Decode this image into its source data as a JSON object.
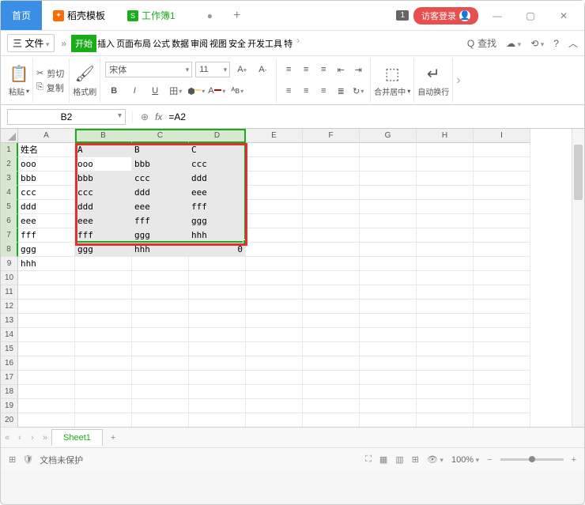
{
  "titlebar": {
    "home": "首页",
    "tab2": "稻壳模板",
    "tab3": "工作簿1",
    "badge": "1",
    "login": "访客登录"
  },
  "menubar": {
    "file": "三 文件",
    "more": "»",
    "tabs": [
      "开始",
      "插入",
      "页面布局",
      "公式",
      "数据",
      "审阅",
      "视图",
      "安全",
      "开发工具",
      "特"
    ],
    "search": "查找"
  },
  "ribbon": {
    "paste": "粘贴",
    "cut": "剪切",
    "copy": "复制",
    "format_painter": "格式刷",
    "font_name": "宋体",
    "font_size": "11",
    "merge": "合并居中",
    "wrap": "自动换行"
  },
  "formula": {
    "namebox": "B2",
    "fx": "fx",
    "value": "=A2"
  },
  "grid": {
    "cols": [
      "A",
      "B",
      "C",
      "D",
      "E",
      "F",
      "G",
      "H",
      "I"
    ],
    "rows": [
      "1",
      "2",
      "3",
      "4",
      "5",
      "6",
      "7",
      "8",
      "9",
      "10",
      "11",
      "12",
      "13",
      "14",
      "15",
      "16",
      "17",
      "18",
      "19",
      "20"
    ],
    "data": [
      [
        "姓名",
        "A",
        "B",
        "C",
        "",
        "",
        "",
        "",
        ""
      ],
      [
        "ooo",
        "ooo",
        "bbb",
        "ccc",
        "",
        "",
        "",
        "",
        ""
      ],
      [
        "bbb",
        "bbb",
        "ccc",
        "ddd",
        "",
        "",
        "",
        "",
        ""
      ],
      [
        "ccc",
        "ccc",
        "ddd",
        "eee",
        "",
        "",
        "",
        "",
        ""
      ],
      [
        "ddd",
        "ddd",
        "eee",
        "fff",
        "",
        "",
        "",
        "",
        ""
      ],
      [
        "eee",
        "eee",
        "fff",
        "ggg",
        "",
        "",
        "",
        "",
        ""
      ],
      [
        "fff",
        "fff",
        "ggg",
        "hhh",
        "",
        "",
        "",
        "",
        ""
      ],
      [
        "ggg",
        "ggg",
        "hhh",
        "0",
        "",
        "",
        "",
        "",
        ""
      ],
      [
        "hhh",
        "",
        "",
        "",
        "",
        "",
        "",
        "",
        ""
      ]
    ]
  },
  "sheets": {
    "tab1": "Sheet1"
  },
  "status": {
    "protect": "文档未保护",
    "zoom": "100%"
  }
}
